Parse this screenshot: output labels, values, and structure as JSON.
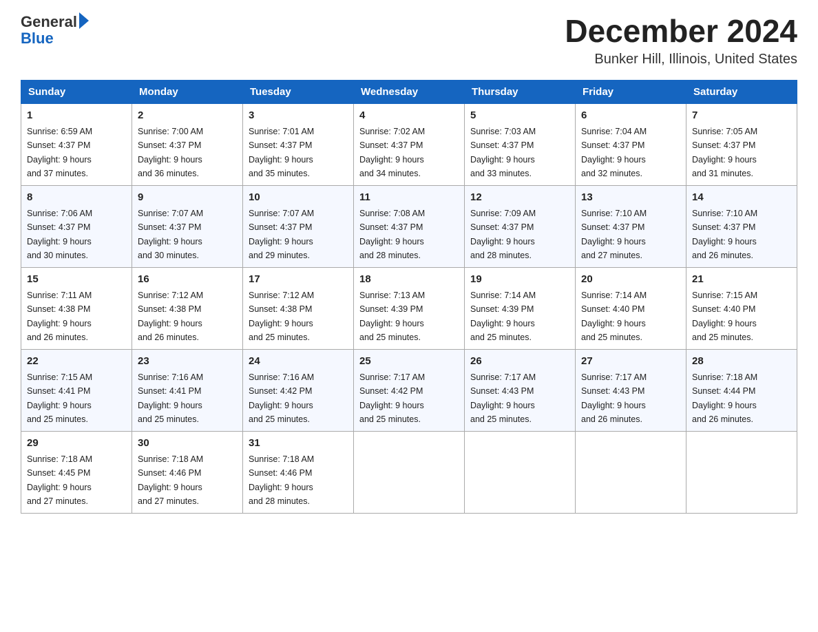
{
  "header": {
    "logo_text_general": "General",
    "logo_text_blue": "Blue",
    "main_title": "December 2024",
    "subtitle": "Bunker Hill, Illinois, United States"
  },
  "weekdays": [
    "Sunday",
    "Monday",
    "Tuesday",
    "Wednesday",
    "Thursday",
    "Friday",
    "Saturday"
  ],
  "weeks": [
    [
      {
        "day": "1",
        "sunrise": "6:59 AM",
        "sunset": "4:37 PM",
        "daylight": "9 hours and 37 minutes."
      },
      {
        "day": "2",
        "sunrise": "7:00 AM",
        "sunset": "4:37 PM",
        "daylight": "9 hours and 36 minutes."
      },
      {
        "day": "3",
        "sunrise": "7:01 AM",
        "sunset": "4:37 PM",
        "daylight": "9 hours and 35 minutes."
      },
      {
        "day": "4",
        "sunrise": "7:02 AM",
        "sunset": "4:37 PM",
        "daylight": "9 hours and 34 minutes."
      },
      {
        "day": "5",
        "sunrise": "7:03 AM",
        "sunset": "4:37 PM",
        "daylight": "9 hours and 33 minutes."
      },
      {
        "day": "6",
        "sunrise": "7:04 AM",
        "sunset": "4:37 PM",
        "daylight": "9 hours and 32 minutes."
      },
      {
        "day": "7",
        "sunrise": "7:05 AM",
        "sunset": "4:37 PM",
        "daylight": "9 hours and 31 minutes."
      }
    ],
    [
      {
        "day": "8",
        "sunrise": "7:06 AM",
        "sunset": "4:37 PM",
        "daylight": "9 hours and 30 minutes."
      },
      {
        "day": "9",
        "sunrise": "7:07 AM",
        "sunset": "4:37 PM",
        "daylight": "9 hours and 30 minutes."
      },
      {
        "day": "10",
        "sunrise": "7:07 AM",
        "sunset": "4:37 PM",
        "daylight": "9 hours and 29 minutes."
      },
      {
        "day": "11",
        "sunrise": "7:08 AM",
        "sunset": "4:37 PM",
        "daylight": "9 hours and 28 minutes."
      },
      {
        "day": "12",
        "sunrise": "7:09 AM",
        "sunset": "4:37 PM",
        "daylight": "9 hours and 28 minutes."
      },
      {
        "day": "13",
        "sunrise": "7:10 AM",
        "sunset": "4:37 PM",
        "daylight": "9 hours and 27 minutes."
      },
      {
        "day": "14",
        "sunrise": "7:10 AM",
        "sunset": "4:37 PM",
        "daylight": "9 hours and 26 minutes."
      }
    ],
    [
      {
        "day": "15",
        "sunrise": "7:11 AM",
        "sunset": "4:38 PM",
        "daylight": "9 hours and 26 minutes."
      },
      {
        "day": "16",
        "sunrise": "7:12 AM",
        "sunset": "4:38 PM",
        "daylight": "9 hours and 26 minutes."
      },
      {
        "day": "17",
        "sunrise": "7:12 AM",
        "sunset": "4:38 PM",
        "daylight": "9 hours and 25 minutes."
      },
      {
        "day": "18",
        "sunrise": "7:13 AM",
        "sunset": "4:39 PM",
        "daylight": "9 hours and 25 minutes."
      },
      {
        "day": "19",
        "sunrise": "7:14 AM",
        "sunset": "4:39 PM",
        "daylight": "9 hours and 25 minutes."
      },
      {
        "day": "20",
        "sunrise": "7:14 AM",
        "sunset": "4:40 PM",
        "daylight": "9 hours and 25 minutes."
      },
      {
        "day": "21",
        "sunrise": "7:15 AM",
        "sunset": "4:40 PM",
        "daylight": "9 hours and 25 minutes."
      }
    ],
    [
      {
        "day": "22",
        "sunrise": "7:15 AM",
        "sunset": "4:41 PM",
        "daylight": "9 hours and 25 minutes."
      },
      {
        "day": "23",
        "sunrise": "7:16 AM",
        "sunset": "4:41 PM",
        "daylight": "9 hours and 25 minutes."
      },
      {
        "day": "24",
        "sunrise": "7:16 AM",
        "sunset": "4:42 PM",
        "daylight": "9 hours and 25 minutes."
      },
      {
        "day": "25",
        "sunrise": "7:17 AM",
        "sunset": "4:42 PM",
        "daylight": "9 hours and 25 minutes."
      },
      {
        "day": "26",
        "sunrise": "7:17 AM",
        "sunset": "4:43 PM",
        "daylight": "9 hours and 25 minutes."
      },
      {
        "day": "27",
        "sunrise": "7:17 AM",
        "sunset": "4:43 PM",
        "daylight": "9 hours and 26 minutes."
      },
      {
        "day": "28",
        "sunrise": "7:18 AM",
        "sunset": "4:44 PM",
        "daylight": "9 hours and 26 minutes."
      }
    ],
    [
      {
        "day": "29",
        "sunrise": "7:18 AM",
        "sunset": "4:45 PM",
        "daylight": "9 hours and 27 minutes."
      },
      {
        "day": "30",
        "sunrise": "7:18 AM",
        "sunset": "4:46 PM",
        "daylight": "9 hours and 27 minutes."
      },
      {
        "day": "31",
        "sunrise": "7:18 AM",
        "sunset": "4:46 PM",
        "daylight": "9 hours and 28 minutes."
      },
      null,
      null,
      null,
      null
    ]
  ],
  "labels": {
    "sunrise": "Sunrise:",
    "sunset": "Sunset:",
    "daylight": "Daylight:"
  }
}
